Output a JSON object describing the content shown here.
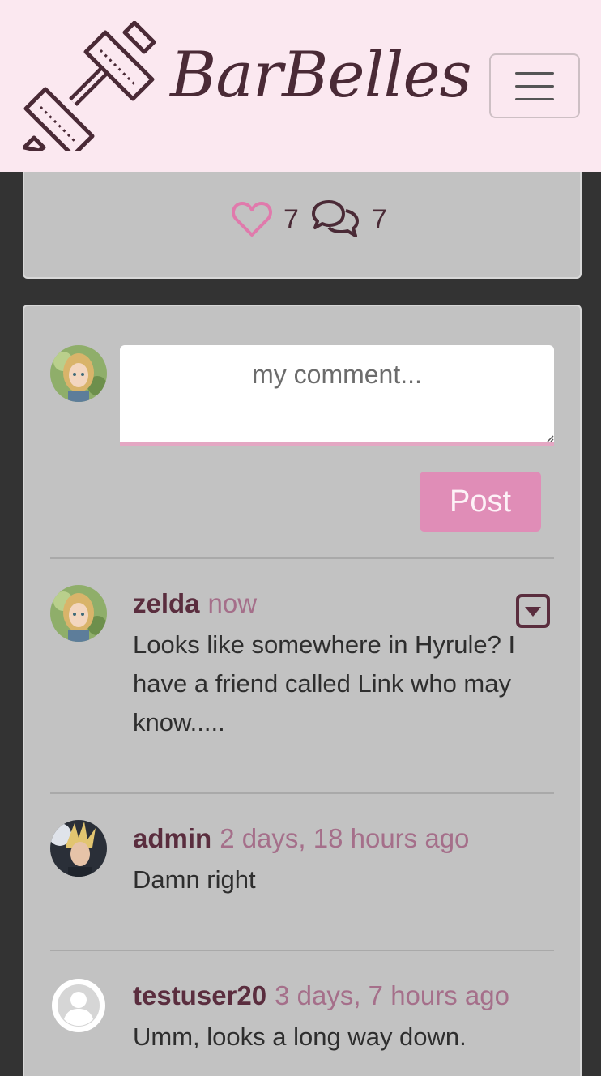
{
  "brand": {
    "name": "BarBelles",
    "logo_icon": "barbell-icon",
    "menu_icon": "hamburger-menu-icon"
  },
  "post_stats": {
    "likes": "7",
    "comments": "7",
    "like_icon": "heart-outline-icon",
    "comment_icon": "chat-bubbles-icon"
  },
  "comment_form": {
    "placeholder": "my comment...",
    "post_label": "Post"
  },
  "comments": [
    {
      "author": "zelda",
      "time": "now",
      "body": "Looks like somewhere in Hyrule? I have a friend called Link who may know.....",
      "has_menu": true
    },
    {
      "author": "admin",
      "time": "2 days, 18 hours ago",
      "body": "Damn right"
    },
    {
      "author": "testuser20",
      "time": "3 days, 7 hours ago",
      "body": "Umm, looks a long way down."
    }
  ],
  "colors": {
    "navbar": "#fbe8f0",
    "brand_text": "#4a2a36",
    "card": "#c2c2c2",
    "accent": "#e08db7",
    "page_bg": "#333333",
    "timestamp": "#a56f8a"
  }
}
